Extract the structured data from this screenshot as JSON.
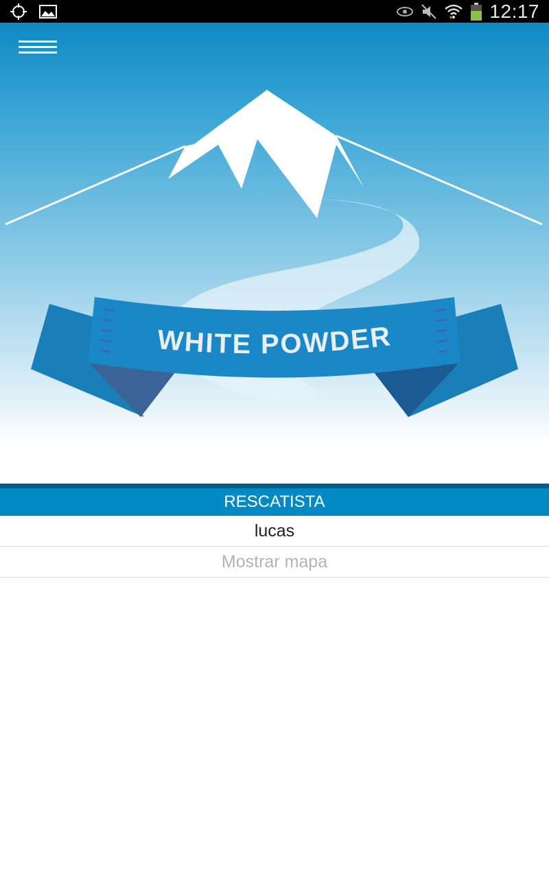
{
  "status_bar": {
    "time": "12:17",
    "icons": [
      "gps-icon",
      "image-icon",
      "eye-icon",
      "mute-icon",
      "wifi-icon",
      "battery-icon"
    ]
  },
  "header": {
    "menu_icon": "hamburger-menu-icon",
    "logo_text": "WHITE POWDER"
  },
  "section": {
    "title": "RESCATISTA"
  },
  "rescuer": {
    "name": "lucas",
    "map_link": "Mostrar mapa"
  },
  "colors": {
    "header_blue": "#0089c2",
    "divider_dark": "#005d8a",
    "banner_blue": "#1a88c7",
    "banner_dark": "#1b5a92"
  }
}
